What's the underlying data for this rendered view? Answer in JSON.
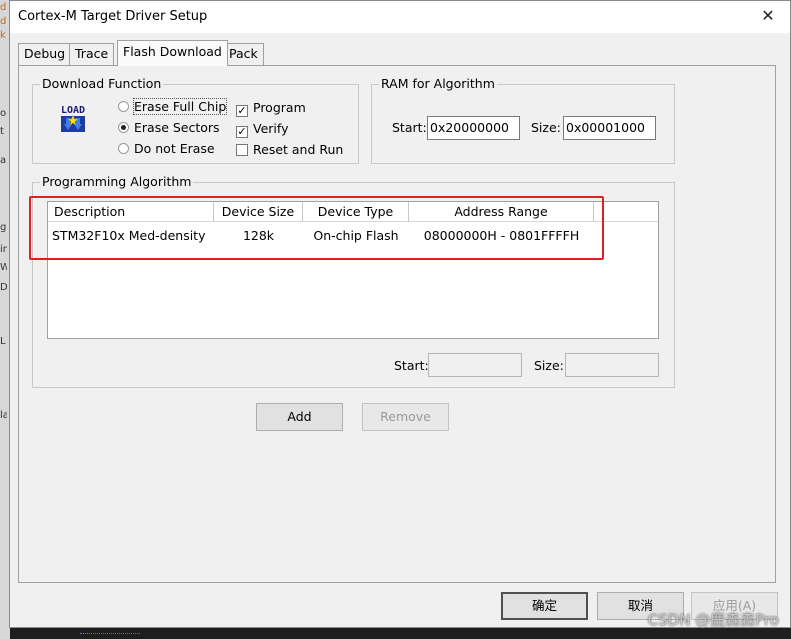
{
  "window": {
    "title": "Cortex-M Target Driver Setup"
  },
  "tabs": [
    "Debug",
    "Trace",
    "Flash Download",
    "Pack"
  ],
  "download_function": {
    "label": "Download Function",
    "icon": "load-icon",
    "icon_text": "LOAD",
    "radios": [
      {
        "label": "Erase Full Chip",
        "selected": false
      },
      {
        "label": "Erase Sectors",
        "selected": true
      },
      {
        "label": "Do not Erase",
        "selected": false
      }
    ],
    "checks": [
      {
        "label": "Program",
        "checked": true
      },
      {
        "label": "Verify",
        "checked": true
      },
      {
        "label": "Reset and Run",
        "checked": false
      }
    ]
  },
  "ram": {
    "label": "RAM for Algorithm",
    "start_label": "Start:",
    "start_value": "0x20000000",
    "size_label": "Size:",
    "size_value": "0x00001000"
  },
  "programming": {
    "label": "Programming Algorithm",
    "columns": [
      "Description",
      "Device Size",
      "Device Type",
      "Address Range"
    ],
    "rows": [
      {
        "description": "STM32F10x Med-density ...",
        "size": "128k",
        "type": "On-chip Flash",
        "range": "08000000H - 0801FFFFH"
      }
    ],
    "start_label": "Start:",
    "size_label": "Size:",
    "start_value": "",
    "size_value": ""
  },
  "buttons": {
    "add": "Add",
    "remove": "Remove",
    "ok": "确定",
    "cancel": "取消",
    "apply": "应用(A)"
  },
  "watermark": "CSDN @鹿森森Pro",
  "colors": {
    "highlight": "#e02020",
    "dialog_bg": "#f0f0f0"
  }
}
